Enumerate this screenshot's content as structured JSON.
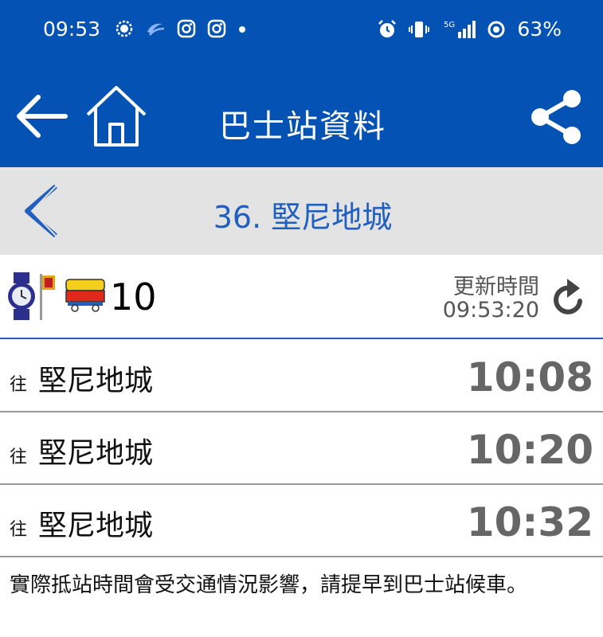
{
  "status_bar": {
    "time": "09:53",
    "battery": "63%",
    "network": "5G",
    "left_icons": [
      "signal-app-icon",
      "messenger-icon",
      "instagram-icon",
      "instagram-icon",
      "dot-icon"
    ],
    "right_icons": [
      "alarm-icon",
      "vibrate-icon",
      "signal-bars-icon",
      "battery-ring-icon"
    ]
  },
  "header": {
    "title": "巴士站資料"
  },
  "stop": {
    "name": "36. 堅尼地城"
  },
  "route": {
    "number": "10",
    "update_label": "更新時間",
    "update_time": "09:53:20"
  },
  "etas": [
    {
      "to": "往",
      "destination": "堅尼地城",
      "time": "10:08"
    },
    {
      "to": "往",
      "destination": "堅尼地城",
      "time": "10:20"
    },
    {
      "to": "往",
      "destination": "堅尼地城",
      "time": "10:32"
    }
  ],
  "notice": "實際抵站時間會受交通情況影響，請提早到巴士站候車。",
  "colors": {
    "header_blue": "#0453b4",
    "subheader_gray": "#e3e3e3",
    "accent_blue": "#1f5fbf",
    "eta_gray": "#666666"
  }
}
